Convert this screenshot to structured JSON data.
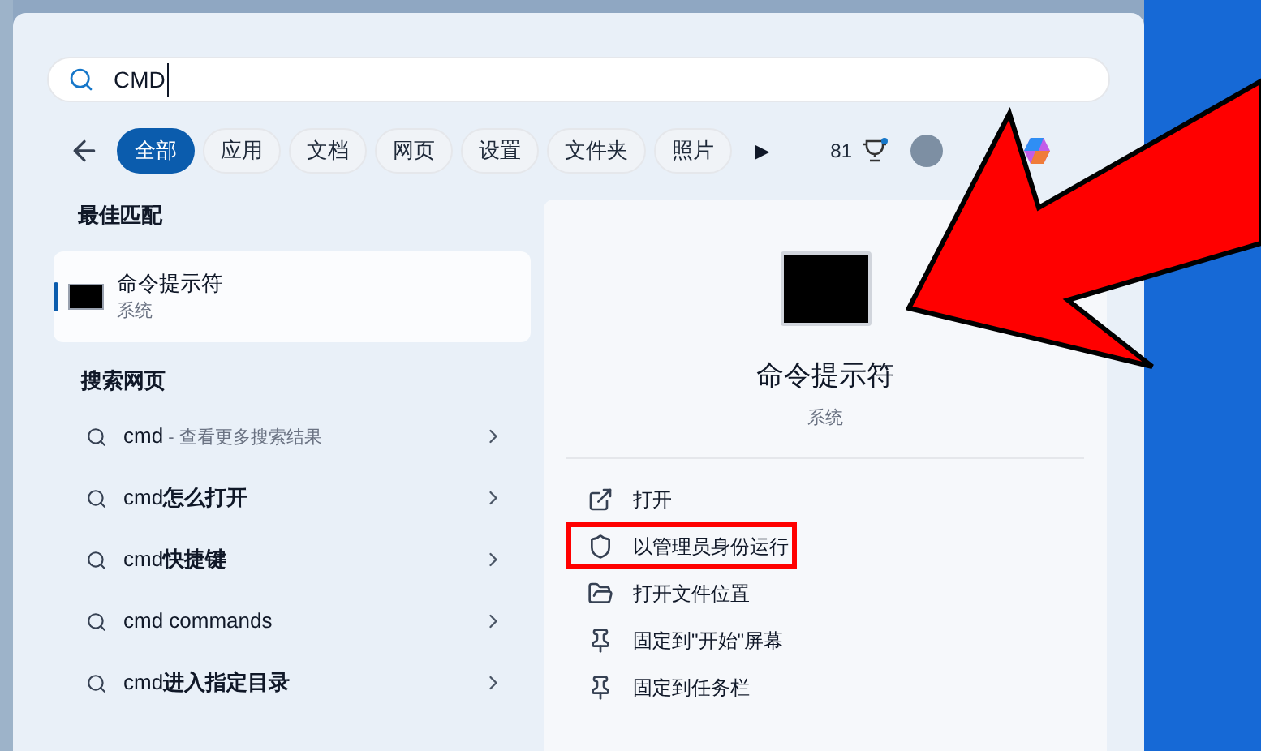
{
  "search": {
    "value": "CMD"
  },
  "filters": [
    {
      "label": "全部",
      "selected": true
    },
    {
      "label": "应用",
      "selected": false
    },
    {
      "label": "文档",
      "selected": false
    },
    {
      "label": "网页",
      "selected": false
    },
    {
      "label": "设置",
      "selected": false
    },
    {
      "label": "文件夹",
      "selected": false
    },
    {
      "label": "照片",
      "selected": false
    }
  ],
  "more": "▶",
  "points": "81",
  "best_match": {
    "heading": "最佳匹配",
    "title": "命令提示符",
    "subtitle": "系统",
    "selected": true
  },
  "web": {
    "heading": "搜索网页",
    "items": [
      {
        "text": "cmd",
        "hint": "- 查看更多搜索结果"
      },
      {
        "text": "cmd**怎么打开**"
      },
      {
        "text": "cmd**快捷键**"
      },
      {
        "text": "cmd commands"
      },
      {
        "text": "cmd**进入指定目录**"
      }
    ]
  },
  "detail": {
    "title": "命令提示符",
    "subtitle": "系统",
    "actions": [
      {
        "kind": "open",
        "label": "打开",
        "highlighted": false
      },
      {
        "kind": "admin",
        "label": "以管理员身份运行",
        "highlighted": true
      },
      {
        "kind": "folder",
        "label": "打开文件位置",
        "highlighted": false
      },
      {
        "kind": "pin",
        "label": "固定到\"开始\"屏幕",
        "highlighted": false
      },
      {
        "kind": "pin",
        "label": "固定到任务栏",
        "highlighted": false
      }
    ]
  }
}
